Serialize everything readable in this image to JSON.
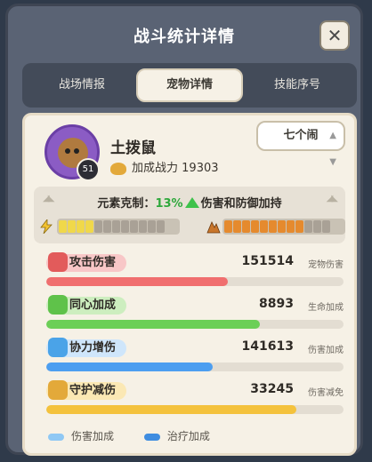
{
  "window": {
    "title": "战斗统计详情",
    "close_label": "✕"
  },
  "tabs": [
    {
      "label": "战场情报",
      "active": false
    },
    {
      "label": "宠物详情",
      "active": true
    },
    {
      "label": "技能序号",
      "active": false
    }
  ],
  "pet": {
    "name": "土拨鼠",
    "level": "51",
    "power_label": "加成战力",
    "power_value": "19303",
    "select_value": "七个闹"
  },
  "element": {
    "prefix": "元素克制：",
    "percent": "13%",
    "suffix": "伤害和防御加持",
    "left_bar": {
      "filled": 4,
      "total": 12,
      "color": "#f0d84a"
    },
    "right_bar": {
      "filled": 9,
      "total": 12,
      "color": "#e58a2e"
    }
  },
  "stats": [
    {
      "label": "攻击伤害",
      "value": "151514",
      "sublabel": "宠物伤害",
      "fraction": 0.61,
      "pill_color": "#f8c7c7",
      "icon_color": "#e25b5b",
      "bar_color": "#f06f6f"
    },
    {
      "label": "同心加成",
      "value": "8893",
      "sublabel": "生命加成",
      "fraction": 0.72,
      "pill_color": "#cdeebf",
      "icon_color": "#5fc24a",
      "bar_color": "#6ccf57"
    },
    {
      "label": "协力增伤",
      "value": "141613",
      "sublabel": "伤害加成",
      "fraction": 0.56,
      "pill_color": "#cfe6fb",
      "icon_color": "#4aa3e8",
      "bar_color": "#4c9ef0"
    },
    {
      "label": "守护减伤",
      "value": "33245",
      "sublabel": "伤害减免",
      "fraction": 0.84,
      "pill_color": "#fbe8b4",
      "icon_color": "#e3a93a",
      "bar_color": "#f4c23c"
    }
  ],
  "legend": [
    {
      "label": "伤害加成",
      "color": "#8fc8f4"
    },
    {
      "label": "治疗加成",
      "color": "#3f8de0"
    }
  ]
}
